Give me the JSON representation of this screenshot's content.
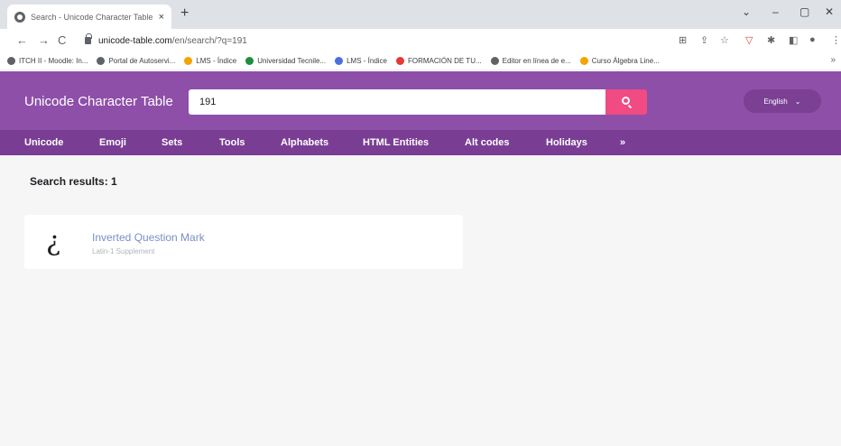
{
  "browser": {
    "tab_title": "Search - Unicode Character Table",
    "tab_close": "×",
    "new_tab": "+",
    "window_controls": [
      "⌄",
      "–",
      "▢",
      "✕"
    ],
    "url_host": "unicode-table.com",
    "url_path": "/en/search/?q=191",
    "nav": {
      "back": "←",
      "forward": "→",
      "reload": "C"
    },
    "toolbar_icons": [
      "⊞",
      "⇪",
      "☆",
      "▽",
      "✱",
      "◧",
      "●",
      "⋮"
    ],
    "bookmarks": [
      {
        "label": "ITCH II - Moodle: In...",
        "color": "#5f6368"
      },
      {
        "label": "Portal de Autoservi...",
        "color": "#5f6368"
      },
      {
        "label": "LMS - Índice",
        "color": "#f4a300"
      },
      {
        "label": "Universidad Tecnile...",
        "color": "#1e8e3e"
      },
      {
        "label": "LMS - Índice",
        "color": "#4a6fe0"
      },
      {
        "label": "FORMACIÓN DE TU...",
        "color": "#e53935"
      },
      {
        "label": "Editor en línea de e...",
        "color": "#5f6368"
      },
      {
        "label": "Curso Álgebra Line...",
        "color": "#f4a300"
      }
    ],
    "bookmarks_more": "»"
  },
  "header": {
    "title": "Unicode Character Table",
    "search_value": "191",
    "language": "English",
    "language_chevron": "⌄"
  },
  "nav": {
    "items": [
      "Unicode",
      "Emoji",
      "Sets",
      "Tools",
      "Alphabets",
      "HTML Entities",
      "Alt codes",
      "Holidays",
      "»"
    ]
  },
  "results": {
    "title": "Search results: 1",
    "items": [
      {
        "char": "¿",
        "name": "Inverted Question Mark",
        "block": "Latin-1 Supplement"
      }
    ]
  },
  "colors": {
    "header_bg": "#8e4fa8",
    "nav_bg": "#7a3d94",
    "search_button": "#f14b83",
    "content_bg": "#f6f6f7",
    "link": "#7a8fc4"
  }
}
